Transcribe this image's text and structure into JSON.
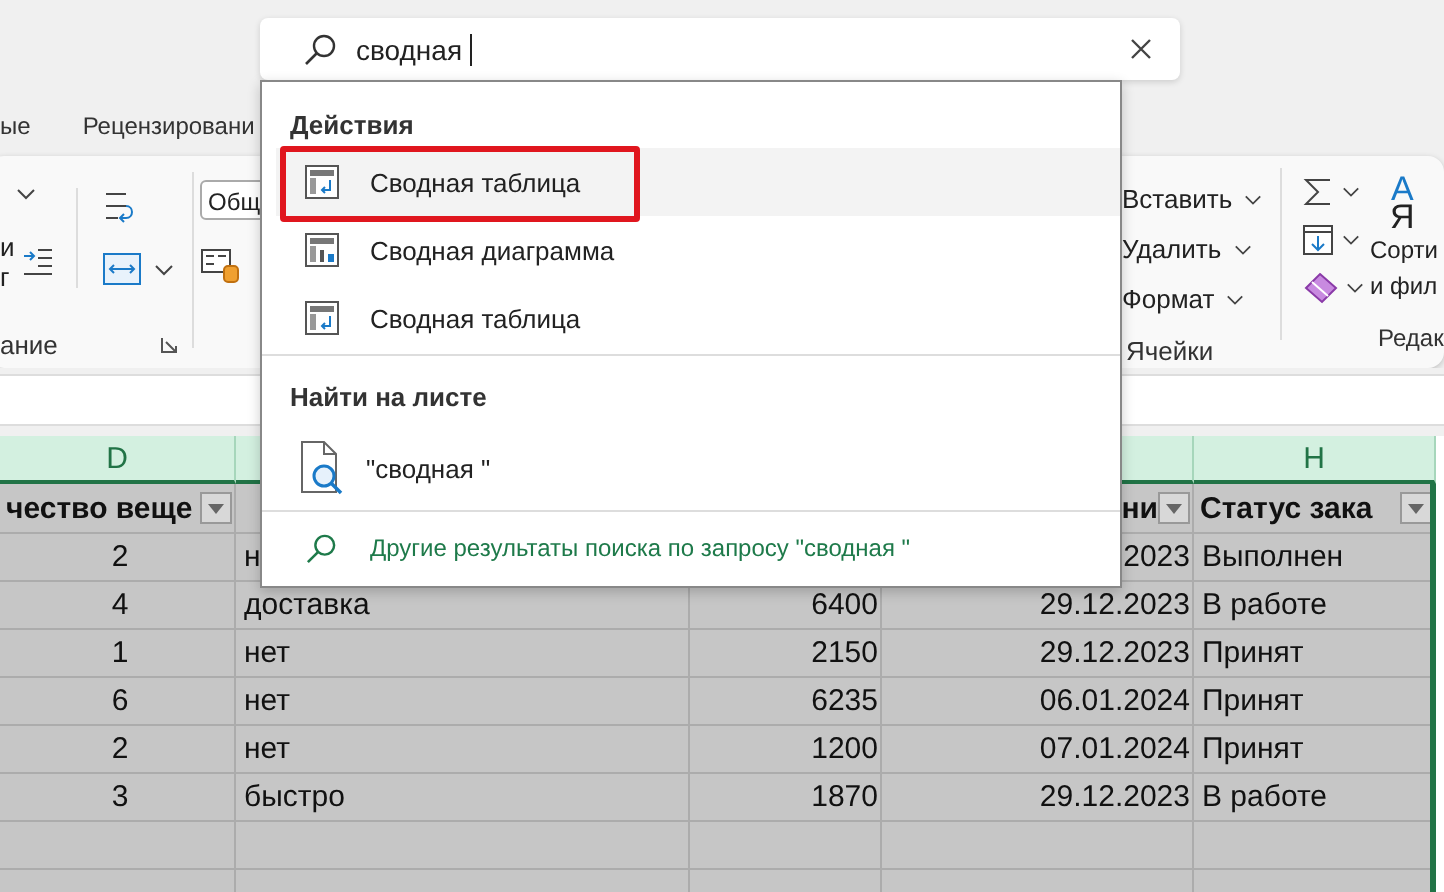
{
  "search": {
    "value": "сводная"
  },
  "ribbon": {
    "tabs": [
      "ые",
      "Рецензировани"
    ],
    "alignment_fragments": [
      "и",
      "г"
    ],
    "alignment_group": "ание",
    "number_format": "Общ",
    "cells_buttons": [
      "Вставить",
      "Удалить",
      "Формат"
    ],
    "cells_group": "Ячейки",
    "sort_icon": {
      "top": "А",
      "bottom": "Я"
    },
    "sort_label": [
      "Сорти",
      "и фил"
    ],
    "editing_group": "Редак"
  },
  "dropdown": {
    "sections": [
      {
        "title": "Действия",
        "items": [
          {
            "kind": "pivot_table",
            "label": "Сводная таблица",
            "selected": true
          },
          {
            "kind": "pivot_chart",
            "label": "Сводная диаграмма",
            "selected": false
          },
          {
            "kind": "pivot_table",
            "label": "Сводная таблица",
            "selected": false
          }
        ]
      },
      {
        "title": "Найти на листе",
        "items": [
          {
            "kind": "find",
            "label": "\"сводная \"",
            "selected": false
          }
        ]
      }
    ],
    "more_results": "Другие результаты поиска по запросу \"сводная \""
  },
  "sheet": {
    "columns": [
      {
        "letter": "D",
        "header": "чество веще",
        "filter": true
      },
      {
        "filter": false
      },
      {},
      {
        "header": "ни",
        "filter": true
      },
      {
        "letter": "H",
        "header": "Статус зака",
        "filter": true
      }
    ],
    "rows": [
      [
        "2",
        "н",
        null,
        "2023",
        "Выполнен"
      ],
      [
        "4",
        "доставка",
        "6400",
        "29.12.2023",
        "В работе"
      ],
      [
        "1",
        "нет",
        "2150",
        "29.12.2023",
        "Принят"
      ],
      [
        "6",
        "нет",
        "6235",
        "06.01.2024",
        "Принят"
      ],
      [
        "2",
        "нет",
        "1200",
        "07.01.2024",
        "Принят"
      ],
      [
        "3",
        "быстро",
        "1870",
        "29.12.2023",
        "В работе"
      ]
    ]
  }
}
